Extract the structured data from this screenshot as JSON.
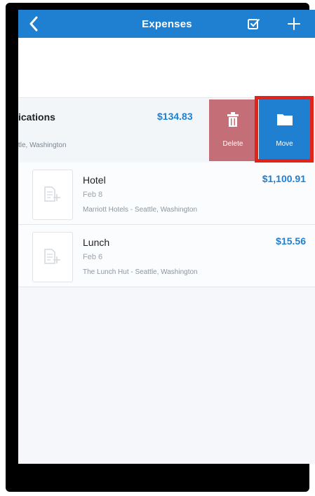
{
  "header": {
    "title": "Expenses",
    "back_icon": "chevron-left-icon",
    "select_icon": "checkbox-icon",
    "add_icon": "plus-icon",
    "color": "#1f7fd0"
  },
  "report": {
    "title": "ications",
    "amount": "$134.83",
    "location": "tle, Washington"
  },
  "actions": {
    "delete_label": "Delete",
    "move_label": "Move",
    "delete_color": "#c46f78",
    "move_color": "#1f7fd0",
    "highlight_color": "#e2231a"
  },
  "expenses": [
    {
      "title": "Hotel",
      "date": "Feb 8",
      "merchant": "Marriott Hotels - Seattle, Washington",
      "amount": "$1,100.91",
      "icon": "add-receipt-icon"
    },
    {
      "title": "Lunch",
      "date": "Feb 6",
      "merchant": "The Lunch Hut - Seattle, Washington",
      "amount": "$15.56",
      "icon": "add-receipt-icon"
    }
  ]
}
